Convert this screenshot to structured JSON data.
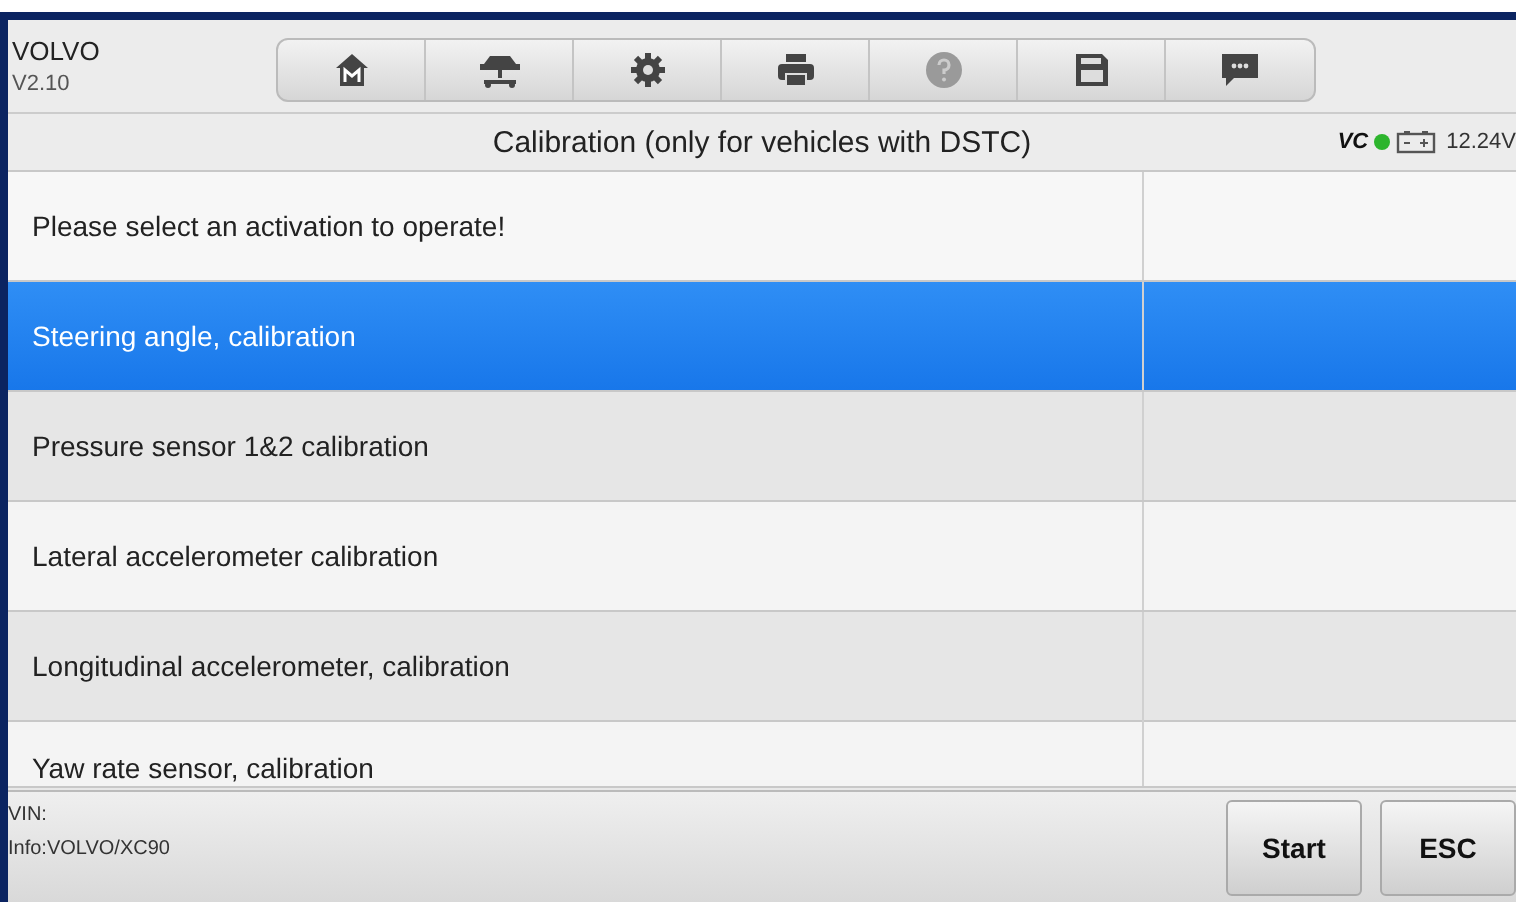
{
  "header": {
    "brand": "VOLVO",
    "version": "V2.10"
  },
  "toolbar": [
    {
      "kind": "home",
      "disabled": false
    },
    {
      "kind": "lift",
      "disabled": false
    },
    {
      "kind": "settings",
      "disabled": false
    },
    {
      "kind": "print",
      "disabled": false
    },
    {
      "kind": "help",
      "disabled": true
    },
    {
      "kind": "save",
      "disabled": false
    },
    {
      "kind": "chat",
      "disabled": false
    }
  ],
  "title_bar": {
    "title": "Calibration (only for vehicles with DSTC)",
    "vci": "VC",
    "voltage": "12.24V"
  },
  "prompt": "Please select an activation to operate!",
  "items": [
    {
      "label": "Steering angle, calibration",
      "selected": true
    },
    {
      "label": "Pressure sensor 1&2 calibration",
      "selected": false
    },
    {
      "label": "Lateral accelerometer calibration",
      "selected": false
    },
    {
      "label": "Longitudinal accelerometer, calibration",
      "selected": false
    },
    {
      "label": "Yaw rate sensor, calibration",
      "selected": false
    }
  ],
  "footer": {
    "vin": "VIN:",
    "info": "Info:VOLVO/XC90",
    "buttons": [
      "Start",
      "ESC"
    ]
  }
}
